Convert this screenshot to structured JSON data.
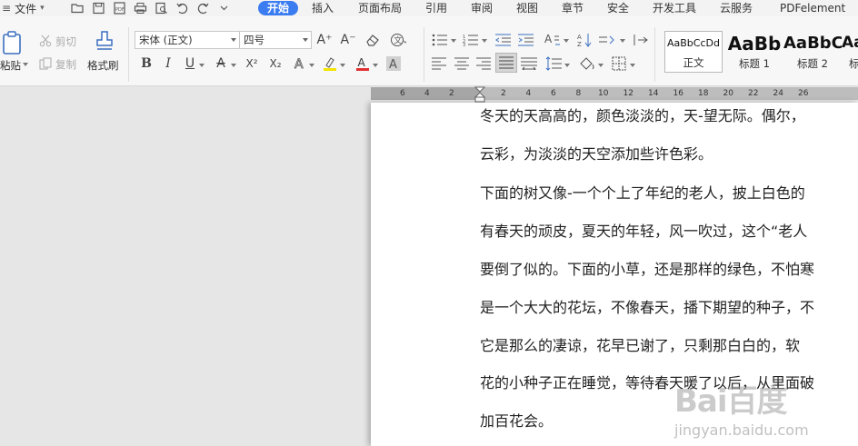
{
  "menu": {
    "file_label": "文件",
    "tabs": [
      {
        "label": "开始",
        "active": true
      },
      {
        "label": "插入"
      },
      {
        "label": "页面布局"
      },
      {
        "label": "引用"
      },
      {
        "label": "审阅"
      },
      {
        "label": "视图"
      },
      {
        "label": "章节"
      },
      {
        "label": "安全"
      },
      {
        "label": "开发工具"
      },
      {
        "label": "云服务"
      },
      {
        "label": "PDFelement"
      }
    ],
    "quick_access_icons": [
      "open-icon",
      "save-icon",
      "pdf-icon",
      "print-icon",
      "print-preview-icon",
      "undo-icon",
      "redo-icon",
      "customize-icon"
    ]
  },
  "ribbon": {
    "paste_label": "粘贴",
    "cut_label": "剪切",
    "copy_label": "复制",
    "format_painter_label": "格式刷",
    "font_name": "宋体 (正文)",
    "font_size": "四号",
    "bold": "B",
    "italic": "I",
    "underline": "U",
    "strikethrough": "A",
    "superscript": "X²",
    "subscript": "X₂",
    "grow_font": "A⁺",
    "shrink_font": "A⁻",
    "styles": [
      {
        "sample": "AaBbCcDd",
        "name": "正文"
      },
      {
        "sample": "AaBb",
        "name": "标题 1"
      },
      {
        "sample": "AaBbC",
        "name": "标题 2"
      },
      {
        "sample": "Aa",
        "name": "标"
      }
    ],
    "accent_color": "#3b7cf1",
    "highlight_color": "#f5e400",
    "font_color": "#e03030"
  },
  "ruler": {
    "labels": [
      "6",
      "4",
      "2",
      "2",
      "4",
      "6",
      "8",
      "10",
      "12",
      "14",
      "16",
      "18",
      "20",
      "22",
      "24",
      "26"
    ]
  },
  "document": {
    "lines": [
      "冬天的天高高的，颜色淡淡的，天-望无际。偶尔，",
      "云彩，为淡淡的天空添加些许色彩。",
      "下面的树又像-一个个上了年纪的老人，披上白色的",
      "有春天的顽皮，夏天的年轻，风一吹过，这个“老人",
      "要倒了似的。下面的小草，还是那样的绿色，不怕寒",
      "是一个大大的花坛，不像春天，播下期望的种子，不",
      "它是那么的凄谅，花早已谢了，只剩那白白的，软",
      "花的小种子正在睡觉，等待春天暖了以后，从里面破",
      "加百花会。"
    ]
  },
  "watermark": {
    "logo": "Bai百度",
    "text": "jingyan.baidu.com"
  }
}
